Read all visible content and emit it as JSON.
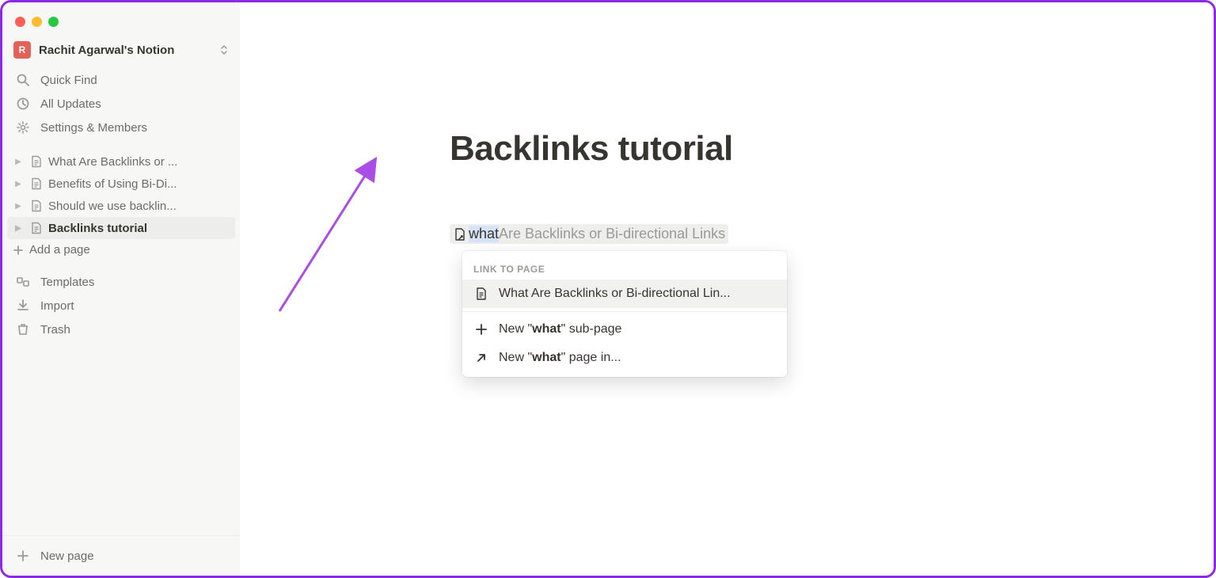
{
  "workspace": {
    "avatar_letter": "R",
    "name": "Rachit Agarwal's Notion"
  },
  "nav": [
    {
      "icon": "search",
      "label": "Quick Find"
    },
    {
      "icon": "clock",
      "label": "All Updates"
    },
    {
      "icon": "gear",
      "label": "Settings & Members"
    }
  ],
  "pages": [
    {
      "label": "What Are Backlinks or ...",
      "active": false
    },
    {
      "label": "Benefits of Using Bi-Di...",
      "active": false
    },
    {
      "label": "Should we use backlin...",
      "active": false
    },
    {
      "label": "Backlinks tutorial",
      "active": true
    }
  ],
  "add_page_label": "Add a page",
  "tools": [
    {
      "icon": "templates",
      "label": "Templates"
    },
    {
      "icon": "import",
      "label": "Import"
    },
    {
      "icon": "trash",
      "label": "Trash"
    }
  ],
  "footer": {
    "new_page_label": "New page"
  },
  "content": {
    "title": "Backlinks tutorial",
    "link_input": {
      "typed": "what",
      "suggestion": " Are Backlinks or Bi-directional Links"
    },
    "popup": {
      "heading": "LINK TO PAGE",
      "result": "What Are Backlinks or Bi-directional Lin...",
      "new_sub_prefix": "New \"",
      "new_sub_term": "what",
      "new_sub_suffix": "\" sub-page",
      "new_in_prefix": "New \"",
      "new_in_term": "what",
      "new_in_suffix": "\" page in..."
    }
  }
}
